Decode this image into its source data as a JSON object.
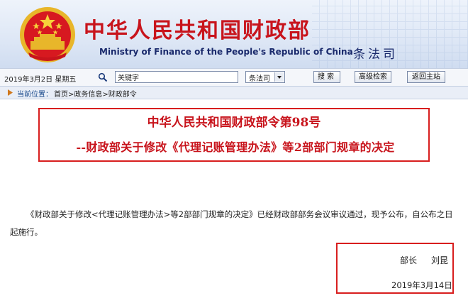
{
  "header": {
    "title_cn": "中华人民共和国财政部",
    "title_en": "Ministry of Finance of the People's Republic of China",
    "department": "条法司"
  },
  "toolbar": {
    "date": "2019年3月2日 星期五",
    "search_value": "关键字",
    "dept_select": "条法司",
    "search_button": "搜索",
    "advanced_button": "高级检索",
    "home_button": "返回主站"
  },
  "breadcrumb": {
    "label": "当前位置：",
    "path": "首页>政务信息>财政部令"
  },
  "document": {
    "title": "中华人民共和国财政部令第98号",
    "subtitle": "--财政部关于修改《代理记账管理办法》等2部部门规章的决定",
    "body": "《财政部关于修改<代理记账管理办法>等2部部门规章的决定》已经财政部部务会议审议通过，现予公布，自公布之日起施行。",
    "signer_title": "部长",
    "signer_name": "刘昆",
    "sign_date": "2019年3月14日"
  },
  "colors": {
    "title_red": "#c8141c",
    "highlight_red": "#d81e1e",
    "navy": "#1a2a6c"
  },
  "icons": {
    "emblem": "national-emblem-icon",
    "search": "magnifier-icon",
    "breadcrumb": "location-arrow-icon",
    "select": "chevron-down-icon"
  }
}
